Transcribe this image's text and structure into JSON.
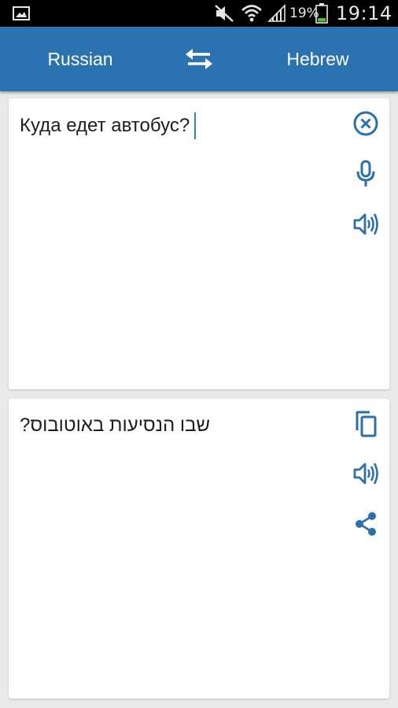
{
  "status_bar": {
    "battery_percent": "19%",
    "time": "19:14",
    "icons": [
      "image-icon",
      "mute-icon",
      "wifi-icon",
      "signal-icon",
      "battery-icon"
    ]
  },
  "app_bar": {
    "source_language": "Russian",
    "target_language": "Hebrew",
    "swap_icon": "swap-icon"
  },
  "source_panel": {
    "text": "Куда едет автобус?",
    "actions": [
      "clear-icon",
      "microphone-icon",
      "speaker-icon"
    ]
  },
  "target_panel": {
    "text": "שבו הנסיעות באוטובוס?",
    "actions": [
      "copy-icon",
      "speaker-icon",
      "share-icon"
    ]
  },
  "colors": {
    "app_bar": "#2b72b0",
    "icon": "#2d6fa8",
    "caret": "#2b85d0",
    "background": "#e9e9e9",
    "status_bar": "#000000"
  }
}
